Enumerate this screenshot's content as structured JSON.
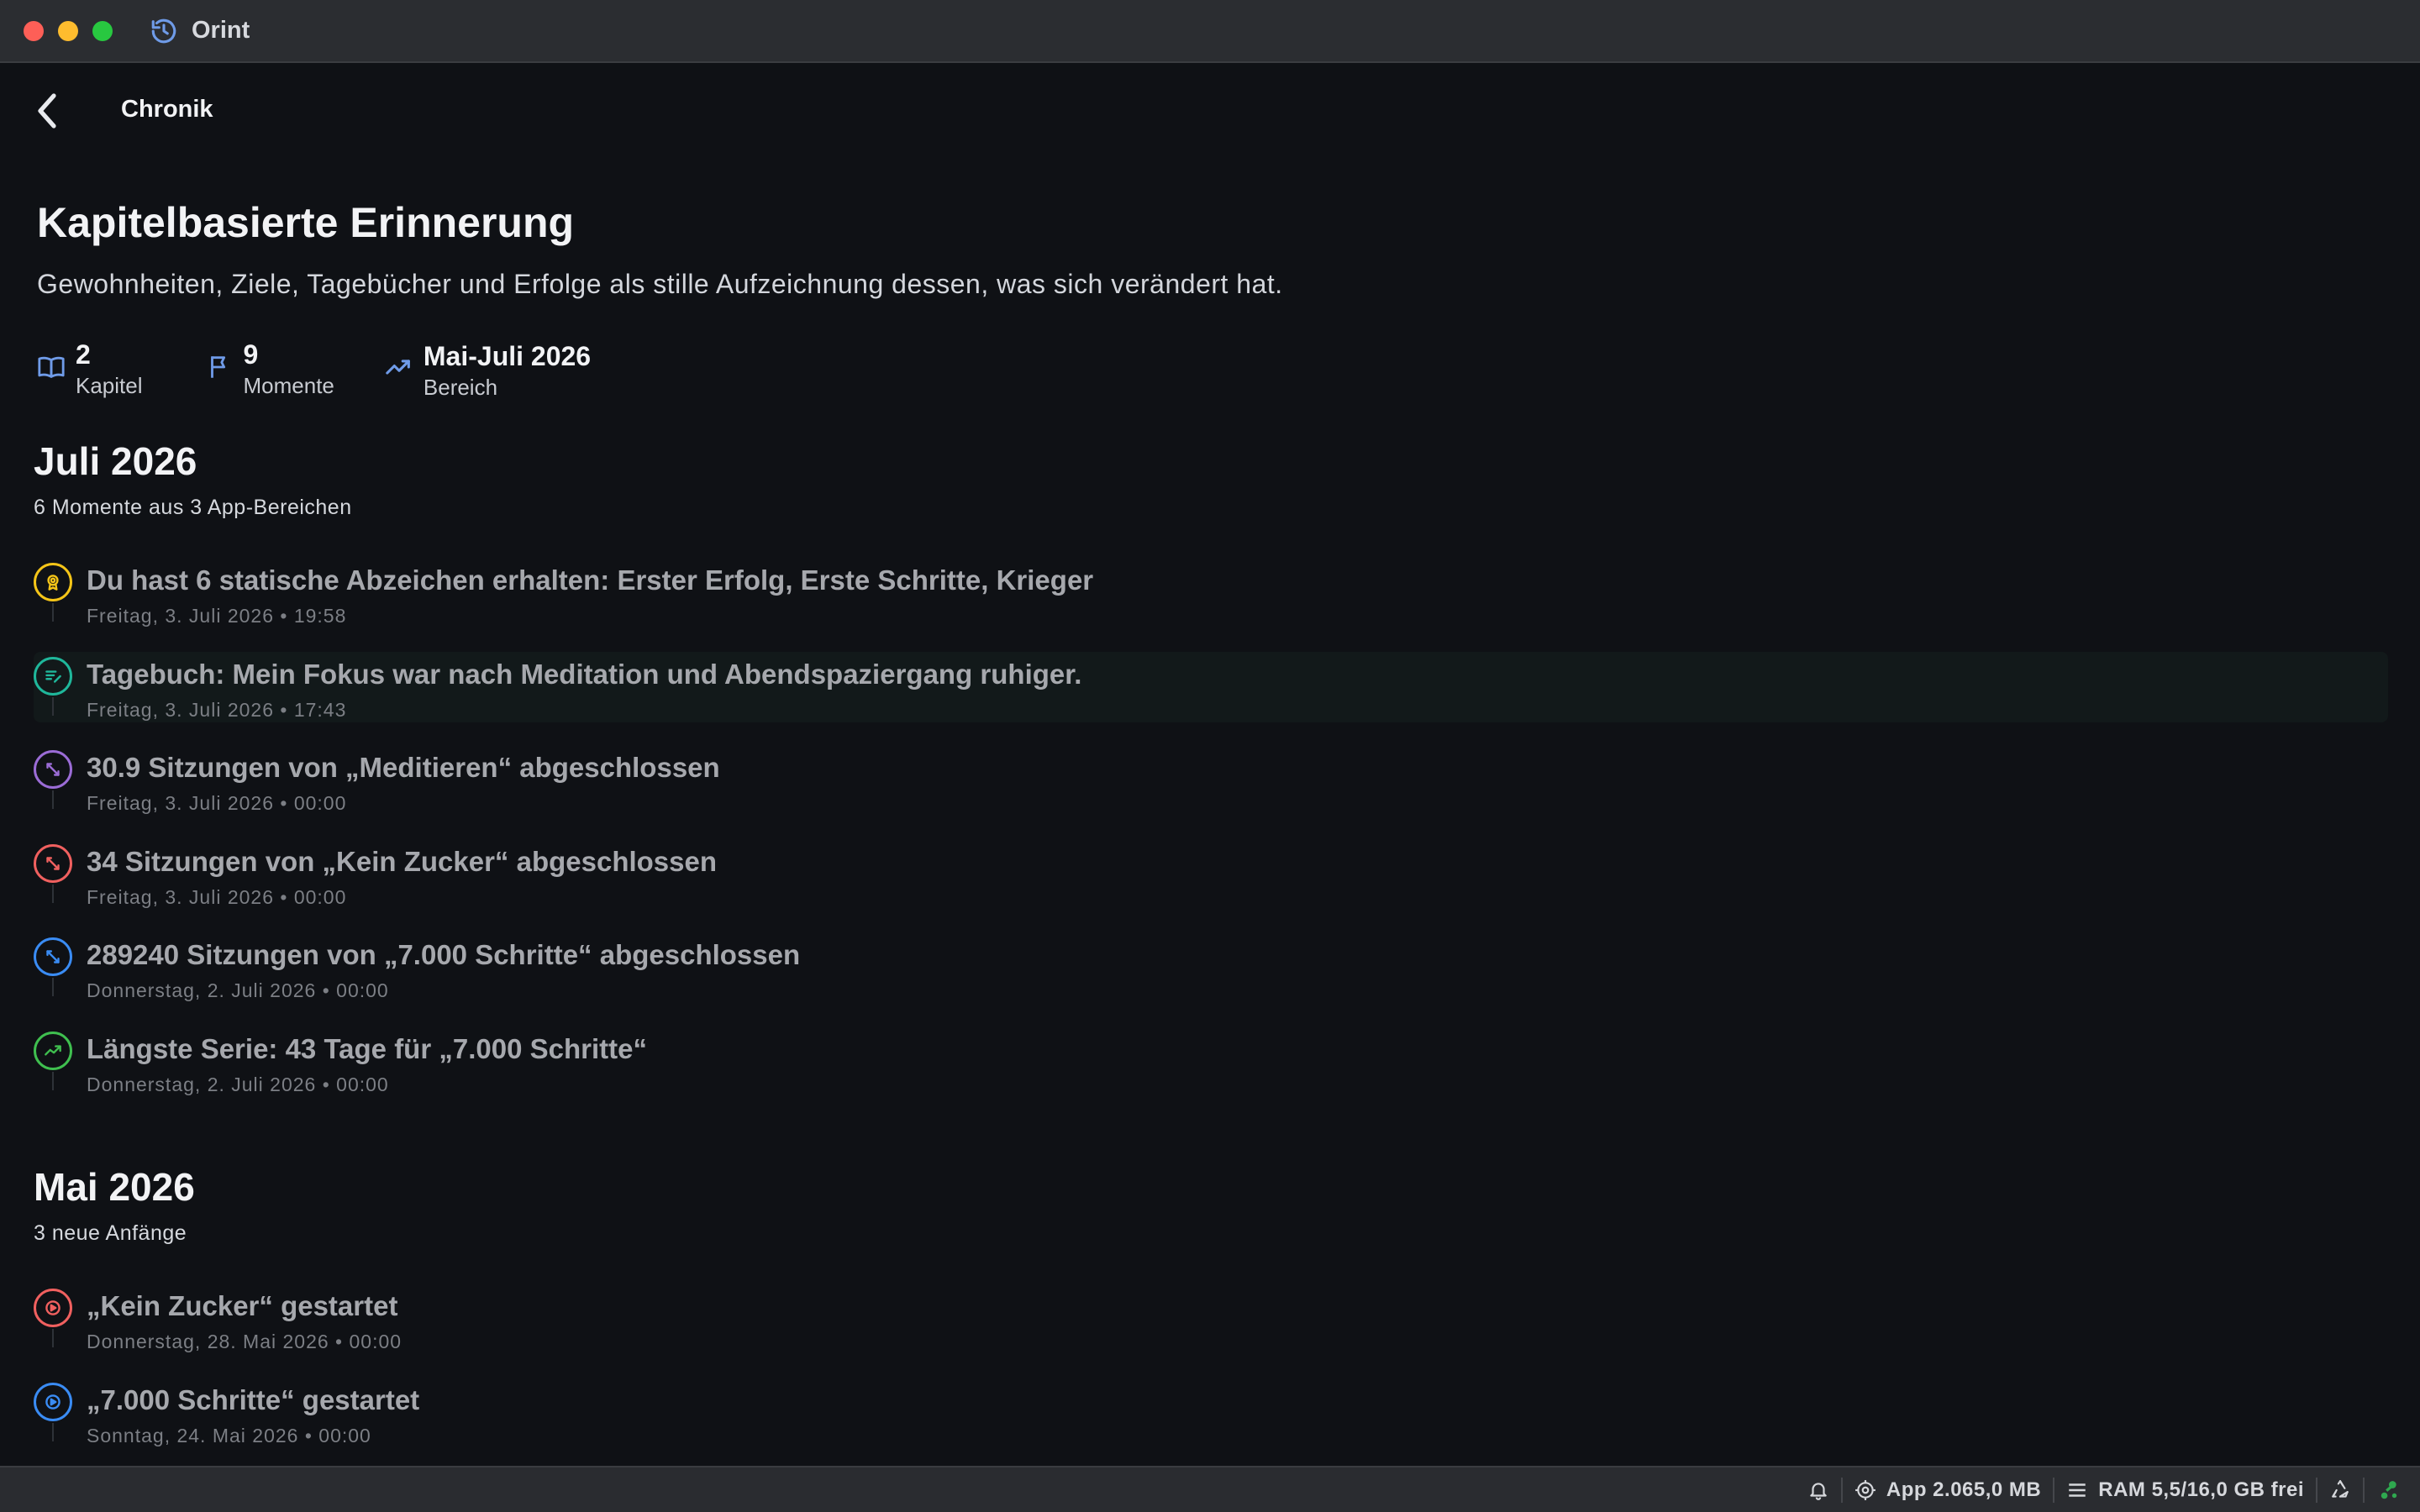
{
  "window": {
    "title": "Orint"
  },
  "nav": {
    "title": "Chronik"
  },
  "header": {
    "title": "Kapitelbasierte Erinnerung",
    "subtitle": "Gewohnheiten, Ziele, Tagebücher und Erfolge als stille Aufzeichnung dessen, was sich verändert hat."
  },
  "stats": [
    {
      "value": "2",
      "label": "Kapitel",
      "icon": "book-icon"
    },
    {
      "value": "9",
      "label": "Momente",
      "icon": "flag-icon"
    },
    {
      "value": "Mai-Juli 2026",
      "label": "Bereich",
      "icon": "trend-icon"
    }
  ],
  "sections": [
    {
      "title": "Juli 2026",
      "subtitle": "6 Momente aus 3 App-Bereichen",
      "entries": [
        {
          "title": "Du hast 6 statische Abzeichen erhalten: Erster Erfolg, Erste Schritte, Krieger",
          "date": "Freitag, 3. Juli 2026 • 19:58",
          "icon": "badge-icon",
          "color": "#f5c518"
        },
        {
          "title": "Tagebuch: Mein Fokus war nach Meditation und Abendspaziergang ruhiger.",
          "date": "Freitag, 3. Juli 2026 • 17:43",
          "icon": "journal-icon",
          "color": "#1fb79b"
        },
        {
          "title": "30.9 Sitzungen von „Meditieren“ abgeschlossen",
          "date": "Freitag, 3. Juli 2026 • 00:00",
          "icon": "arrows-icon",
          "color": "#9b6cd6"
        },
        {
          "title": "34 Sitzungen von „Kein Zucker“ abgeschlossen",
          "date": "Freitag, 3. Juli 2026 • 00:00",
          "icon": "arrows-icon",
          "color": "#f0605f"
        },
        {
          "title": "289240 Sitzungen von „7.000 Schritte“ abgeschlossen",
          "date": "Donnerstag, 2. Juli 2026 • 00:00",
          "icon": "arrows-icon",
          "color": "#3a8cf4"
        },
        {
          "title": "Längste Serie: 43 Tage für „7.000 Schritte“",
          "date": "Donnerstag, 2. Juli 2026 • 00:00",
          "icon": "trend-icon",
          "color": "#3fbf4f"
        }
      ]
    },
    {
      "title": "Mai 2026",
      "subtitle": "3 neue Anfänge",
      "entries": [
        {
          "title": "„Kein Zucker“ gestartet",
          "date": "Donnerstag, 28. Mai 2026 • 00:00",
          "icon": "play-icon",
          "color": "#f0605f"
        },
        {
          "title": "„7.000 Schritte“ gestartet",
          "date": "Sonntag, 24. Mai 2026 • 00:00",
          "icon": "play-icon",
          "color": "#3a8cf4"
        }
      ]
    }
  ],
  "statusbar": {
    "app_memory": "App 2.065,0 MB",
    "ram": "RAM 5,5/16,0 GB frei"
  }
}
